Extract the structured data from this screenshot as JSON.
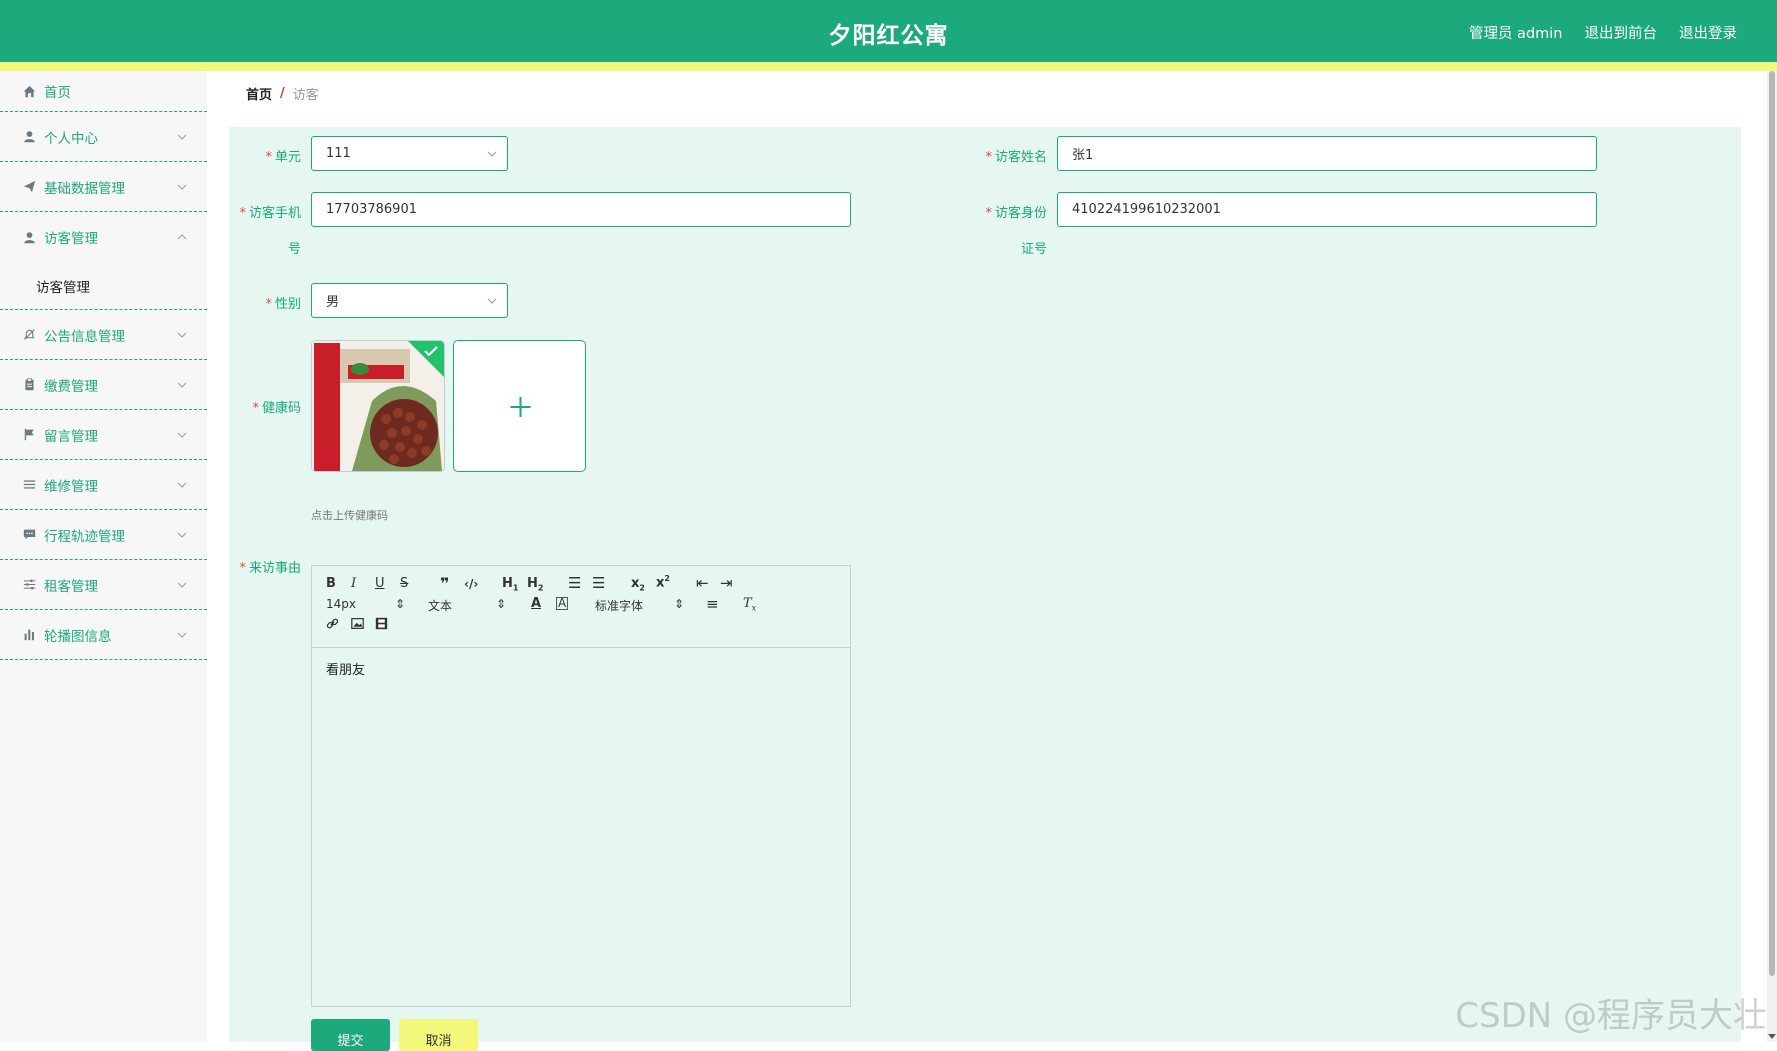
{
  "header": {
    "title": "夕阳红公寓",
    "user_label": "管理员 admin",
    "to_front_label": "退出到前台",
    "logout_label": "退出登录"
  },
  "sidebar": {
    "items": [
      {
        "label": "首页",
        "icon": "home-icon"
      },
      {
        "label": "个人中心",
        "icon": "user-icon"
      },
      {
        "label": "基础数据管理",
        "icon": "paper-plane-icon"
      },
      {
        "label": "访客管理",
        "icon": "user-icon",
        "expanded": true,
        "sub": [
          "访客管理"
        ]
      },
      {
        "label": "公告信息管理",
        "icon": "bell-off-icon"
      },
      {
        "label": "缴费管理",
        "icon": "clipboard-icon"
      },
      {
        "label": "留言管理",
        "icon": "flag-icon"
      },
      {
        "label": "维修管理",
        "icon": "list-icon"
      },
      {
        "label": "行程轨迹管理",
        "icon": "chat-icon"
      },
      {
        "label": "租客管理",
        "icon": "sliders-icon"
      },
      {
        "label": "轮播图信息",
        "icon": "bar-chart-icon"
      }
    ]
  },
  "breadcrumb": {
    "home": "首页",
    "separator": "/",
    "current": "访客"
  },
  "form": {
    "unit": {
      "label": "单元",
      "value": "111"
    },
    "visitor_name": {
      "label": "访客姓名",
      "value": "张1"
    },
    "visitor_phone": {
      "label_line1": "访客手机",
      "label_line2": "号",
      "value": "17703786901"
    },
    "visitor_id": {
      "label_line1": "访客身份",
      "label_line2": "证号",
      "value": "410224199610232001"
    },
    "gender": {
      "label": "性别",
      "value": "男"
    },
    "health_code": {
      "label": "健康码",
      "tip": "点击上传健康码"
    },
    "reason": {
      "label": "来访事由",
      "toolbar": {
        "font_size": "14px",
        "header": "文本",
        "font_family": "标准字体"
      },
      "content": "看朋友"
    },
    "submit_label": "提交",
    "cancel_label": "取消"
  },
  "watermark": "CSDN @程序员大壮",
  "colors": {
    "primary": "#1caa7c",
    "accent": "#f3f77a",
    "panel": "#e6f6f0",
    "required": "#e74c3c"
  }
}
